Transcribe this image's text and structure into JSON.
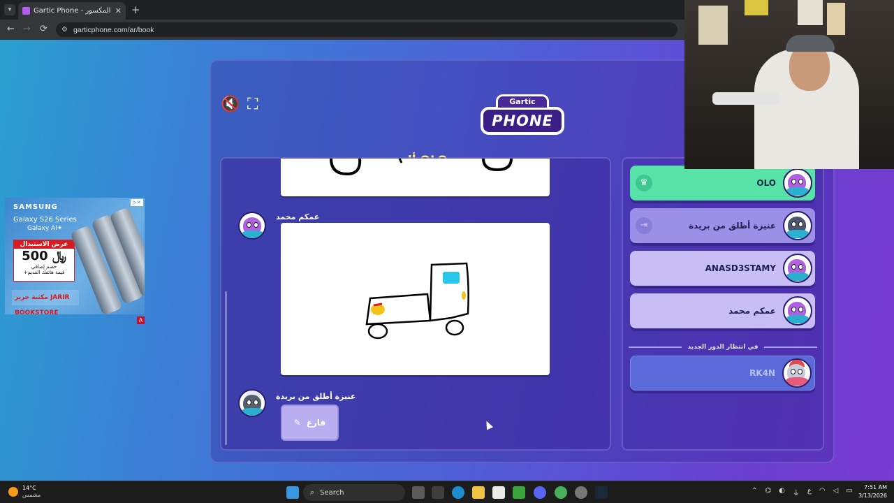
{
  "browser": {
    "tab_title": "Gartic Phone - الهاتف المكسور",
    "tab_close": "✕",
    "new_tab": "+",
    "back": "←",
    "forward": "→",
    "reload": "⟳",
    "url": "garticphone.com/ar/book"
  },
  "ad": {
    "brand": "SAMSUNG",
    "line1": "Galaxy S26 Series",
    "line2": "Galaxy AI✦",
    "offer": "عرض الاستبدال",
    "price": "500 ﷼",
    "price_note": "خصم إضافي",
    "sub": "+قيمة هاتفك القديم",
    "store": "مكتبة جرير JARIR BOOKSTORE",
    "adchoices": "▷✕",
    "corner": "A"
  },
  "game": {
    "mute_icon": "🔇",
    "fullscreen_icon": "⛶",
    "logo_top": "Gartic",
    "logo_main": "PHONE",
    "album_title": "ألبوم OLO",
    "album": {
      "entry_name": "عمكم محمد",
      "empty_author": "عنيزة أطلق من بريدة",
      "empty_label": "فارغ",
      "pencil_icon": "✎"
    },
    "players": [
      {
        "name": "OLO",
        "icon": "♛"
      },
      {
        "name": "عنيزة أطلق من بريدة",
        "icon": "⇥"
      },
      {
        "name": "ANASD3STAMY",
        "icon": ""
      },
      {
        "name": "عمكم محمد",
        "icon": ""
      }
    ],
    "waiting_label": "في انتظار الدور الجديد",
    "waiting_players": [
      {
        "name": "RK4N"
      }
    ]
  },
  "taskbar": {
    "temperature": "14°C",
    "weather": "مشمس",
    "search_label": "Search",
    "time": "7:51 AM",
    "date": "3/13/2026",
    "lang": "ع"
  },
  "colors": {
    "accent_green": "#57e3a8",
    "player_lavender": "#c9bdf6",
    "title_yellow": "#f7f06a"
  }
}
